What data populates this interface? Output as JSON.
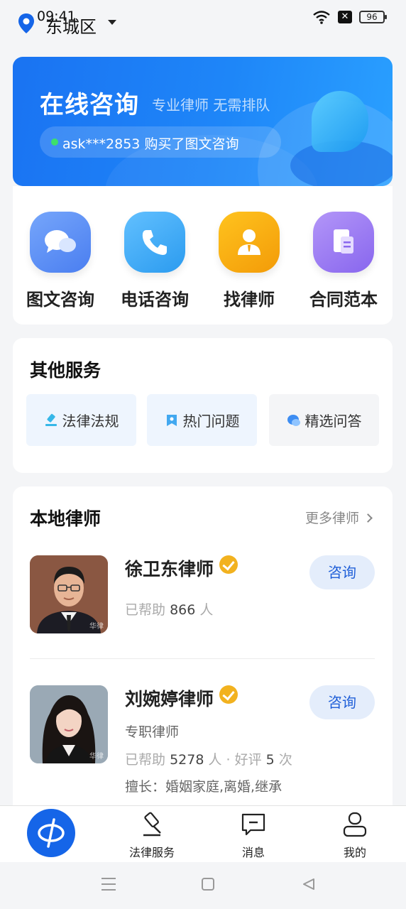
{
  "status_bar": {
    "time": "09:41",
    "battery": "96",
    "no_sim": "✕"
  },
  "location": {
    "city": "东城区"
  },
  "banner": {
    "title": "在线咨询",
    "subtitle": "专业律师 无需排队",
    "ticker": "ask***2853 购买了图文咨询"
  },
  "quick_services": [
    {
      "label": "图文咨询",
      "icon": "chat-bubbles-icon",
      "color": "#5b8cf4"
    },
    {
      "label": "电话咨询",
      "icon": "phone-icon",
      "color": "#3aaaf5"
    },
    {
      "label": "找律师",
      "icon": "lawyer-person-icon",
      "color": "#f5a612"
    },
    {
      "label": "合同范本",
      "icon": "document-icon",
      "color": "#9b7af0"
    }
  ],
  "other_services": {
    "title": "其他服务",
    "items": [
      {
        "label": "法律法规",
        "icon": "gavel-icon"
      },
      {
        "label": "热门问题",
        "icon": "bookmark-icon"
      },
      {
        "label": "精选问答",
        "icon": "qa-bubble-icon"
      }
    ]
  },
  "local_lawyers": {
    "title": "本地律师",
    "more": "更多律师",
    "consult_label": "咨询",
    "helped_prefix": "已帮助",
    "helped_unit": "人",
    "rating_prefix": "· 好评",
    "rating_unit": "次",
    "list": [
      {
        "name": "徐卫东律师",
        "helped": "866",
        "watermark": "华律"
      },
      {
        "name": "刘婉婷律师",
        "title": "专职律师",
        "helped": "5278",
        "rating": "5",
        "specialty": "擅长：婚姻家庭,离婚,继承",
        "watermark": "华律"
      }
    ]
  },
  "tabbar": {
    "items": [
      {
        "label": "法律服务",
        "icon": "gavel-icon"
      },
      {
        "label": "消息",
        "icon": "message-icon"
      },
      {
        "label": "我的",
        "icon": "user-icon"
      }
    ]
  }
}
